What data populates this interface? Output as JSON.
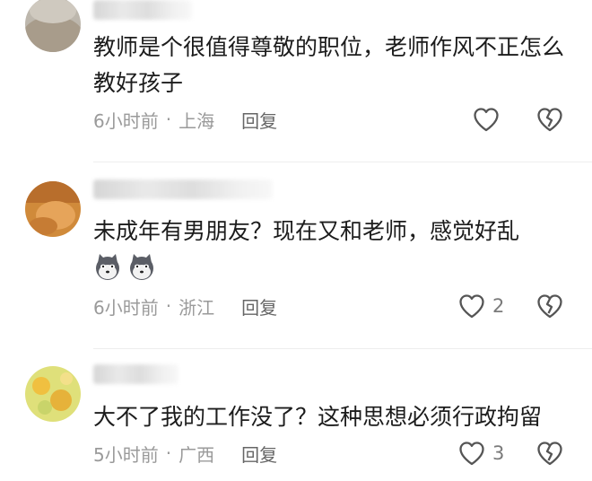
{
  "comments": [
    {
      "text": "教师是个很值得尊敬的职位，老师作风不正怎么教好孩子",
      "time": "6小时前",
      "location": "上海",
      "reply_label": "回复",
      "likes": ""
    },
    {
      "text": "未成年有男朋友？现在又和老师，感觉好乱",
      "emojis": [
        "dog-emoji",
        "dog-emoji"
      ],
      "time": "6小时前",
      "location": "浙江",
      "reply_label": "回复",
      "likes": "2"
    },
    {
      "text": "大不了我的工作没了？这种思想必须行政拘留",
      "time": "5小时前",
      "location": "广西",
      "reply_label": "回复",
      "likes": "3"
    }
  ],
  "separator": "·",
  "icons": {
    "like": "heart-outline-icon",
    "dislike": "broken-heart-icon"
  },
  "colors": {
    "text": "#1c1c1c",
    "meta": "#9a9a9a",
    "reply": "#666666",
    "icon": "#555555"
  }
}
